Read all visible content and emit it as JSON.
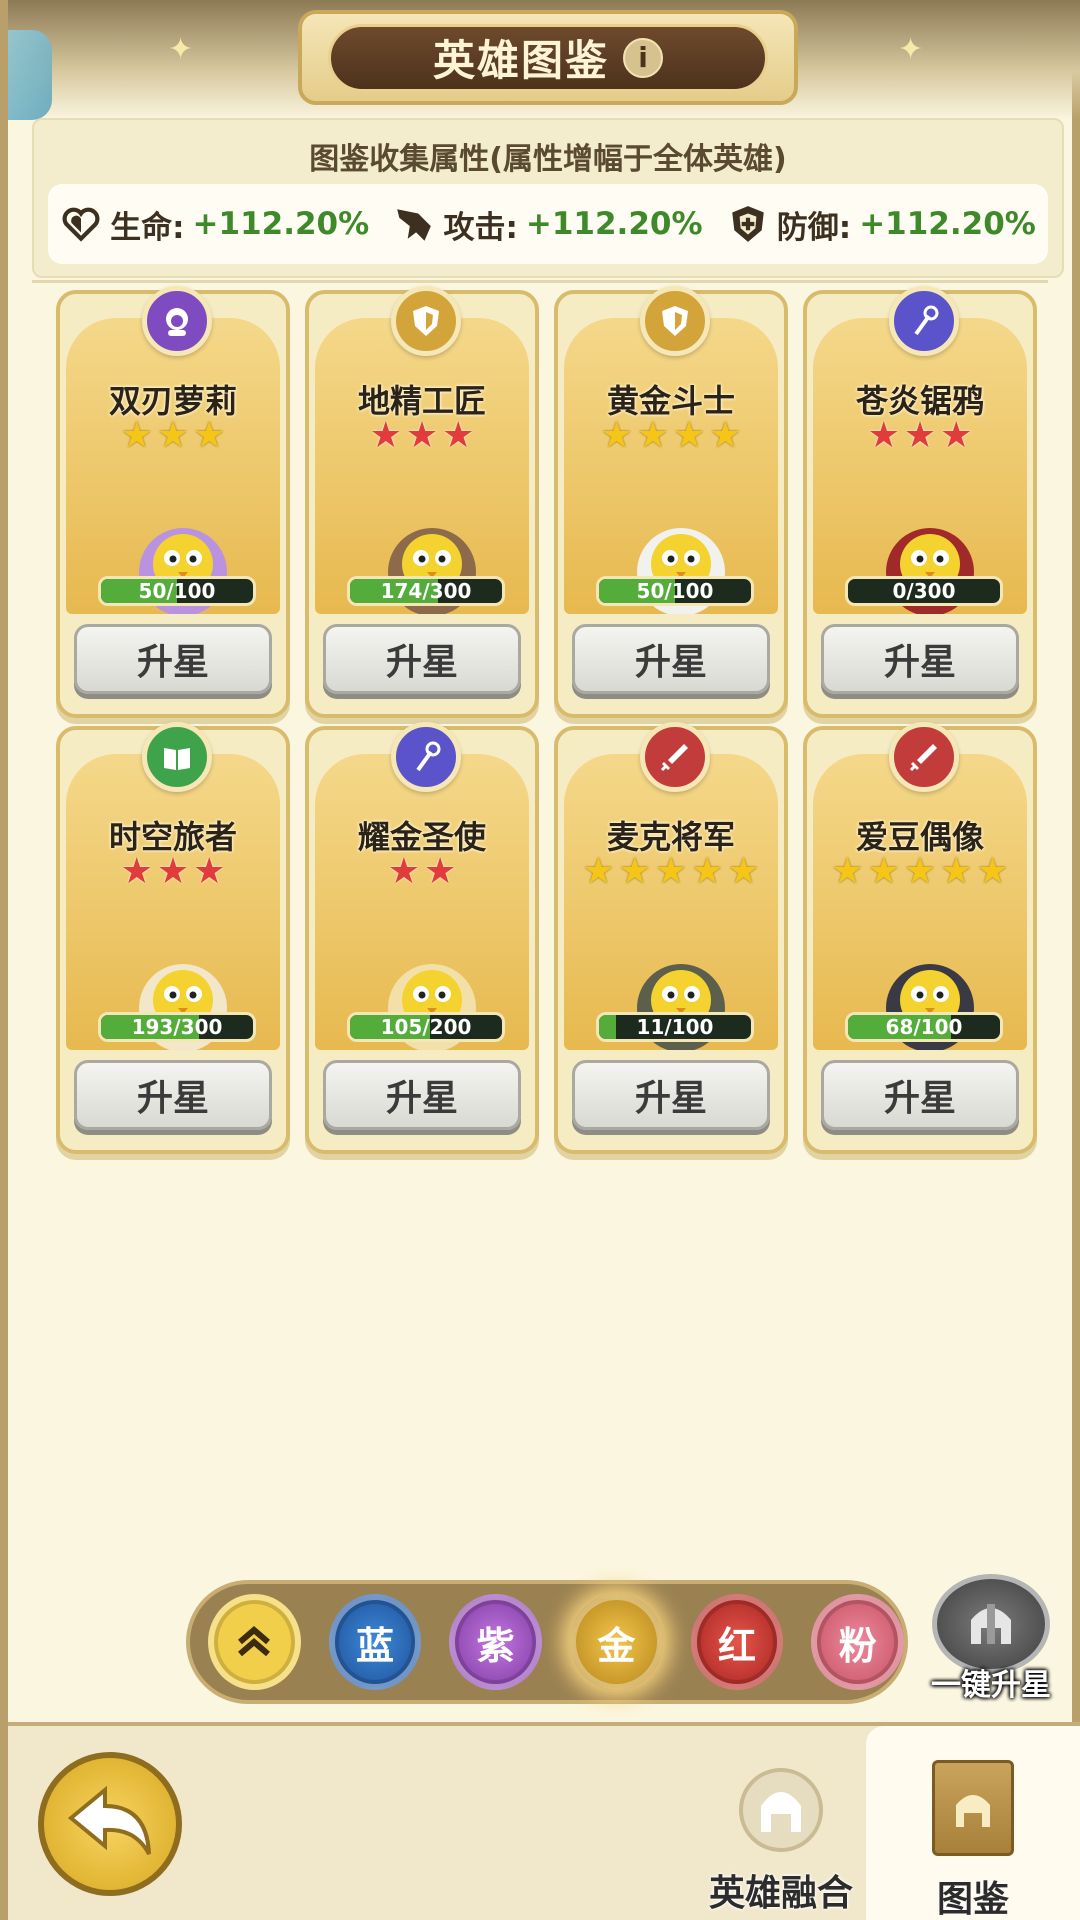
{
  "header": {
    "title": "英雄图鉴",
    "info_icon": "i"
  },
  "stats": {
    "title": "图鉴收集属性(属性增幅于全体英雄)",
    "items": [
      {
        "label": "生命:",
        "value": "+112.20%",
        "icon": "heart-icon"
      },
      {
        "label": "攻击:",
        "value": "+112.20%",
        "icon": "sword-icon"
      },
      {
        "label": "防御:",
        "value": "+112.20%",
        "icon": "shield-icon"
      }
    ]
  },
  "heroes": [
    {
      "name": "双刃萝莉",
      "badge": "hood-icon",
      "badge_color": "#7e4bc0",
      "stars": 3,
      "star_color": "gold",
      "progress": "50/100",
      "fill": 0.5,
      "button": "升星"
    },
    {
      "name": "地精工匠",
      "badge": "shield-icon",
      "badge_color": "#d2a43a",
      "stars": 3,
      "star_color": "red",
      "progress": "174/300",
      "fill": 0.58,
      "button": "升星"
    },
    {
      "name": "黄金斗士",
      "badge": "shield-icon",
      "badge_color": "#d2a43a",
      "stars": 4,
      "star_color": "gold",
      "progress": "50/100",
      "fill": 0.5,
      "button": "升星"
    },
    {
      "name": "苍炎锯鸦",
      "badge": "staff-icon",
      "badge_color": "#5b53c9",
      "stars": 3,
      "star_color": "red",
      "progress": "0/300",
      "fill": 0,
      "button": "升星"
    },
    {
      "name": "时空旅者",
      "badge": "book-icon",
      "badge_color": "#3fa34b",
      "stars": 3,
      "star_color": "red",
      "progress": "193/300",
      "fill": 0.643,
      "button": "升星"
    },
    {
      "name": "耀金圣使",
      "badge": "staff-icon",
      "badge_color": "#5b53c9",
      "stars": 2,
      "star_color": "red",
      "progress": "105/200",
      "fill": 0.525,
      "button": "升星"
    },
    {
      "name": "麦克将军",
      "badge": "sword-icon",
      "badge_color": "#c23c3c",
      "stars": 5,
      "star_color": "gold",
      "progress": "11/100",
      "fill": 0.11,
      "button": "升星"
    },
    {
      "name": "爱豆偶像",
      "badge": "sword-icon",
      "badge_color": "#c23c3c",
      "stars": 5,
      "star_color": "gold",
      "progress": "68/100",
      "fill": 0.68,
      "button": "升星"
    }
  ],
  "filters": [
    {
      "label": "",
      "type": "collapse",
      "icon": "double-chevron-up-icon"
    },
    {
      "label": "蓝",
      "type": "blue"
    },
    {
      "label": "紫",
      "type": "purple"
    },
    {
      "label": "金",
      "type": "gold",
      "selected": true
    },
    {
      "label": "红",
      "type": "red"
    },
    {
      "label": "粉",
      "type": "pink"
    }
  ],
  "one_key_upgrade": {
    "label": "一键升星",
    "icon": "helmet-icon"
  },
  "bottom_nav": {
    "back_icon": "back-arrow-icon",
    "fusion_label": "英雄融合",
    "codex_label": "图鉴"
  }
}
